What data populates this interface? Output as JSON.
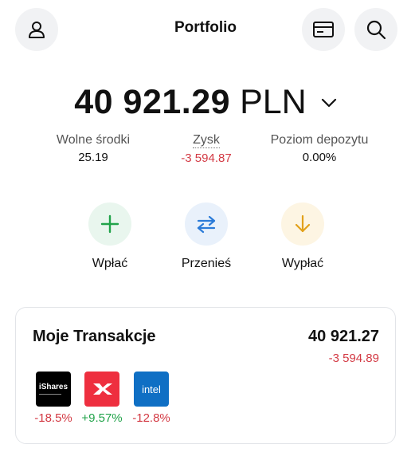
{
  "header": {
    "title": "Portfolio",
    "profile_icon": "user-icon",
    "card_icon": "card-icon",
    "search_icon": "search-icon"
  },
  "balance": {
    "amount": "40 921.29",
    "currency": "PLN"
  },
  "stats": [
    {
      "label": "Wolne środki",
      "value": "25.19"
    },
    {
      "label": "Zysk",
      "value": "-3 594.87"
    },
    {
      "label": "Poziom depozytu",
      "value": "0.00%"
    }
  ],
  "actions": [
    {
      "label": "Wpłać",
      "icon": "plus-icon",
      "color": "#21a34a"
    },
    {
      "label": "Przenieś",
      "icon": "transfer-icon",
      "color": "#2b7bd8"
    },
    {
      "label": "Wypłać",
      "icon": "arrow-down-icon",
      "color": "#e2a11a"
    }
  ],
  "transactions": {
    "title": "Moje Transakcje",
    "total": "40 921.27",
    "change": "-3 594.89",
    "holdings": [
      {
        "logo_text": "iShares",
        "change": "-18.5%"
      },
      {
        "logo_text": "",
        "change": "+9.57%"
      },
      {
        "logo_text": "intel",
        "change": "-12.8%"
      }
    ]
  },
  "colors": {
    "negative": "#d33a44",
    "positive": "#21a34a"
  }
}
